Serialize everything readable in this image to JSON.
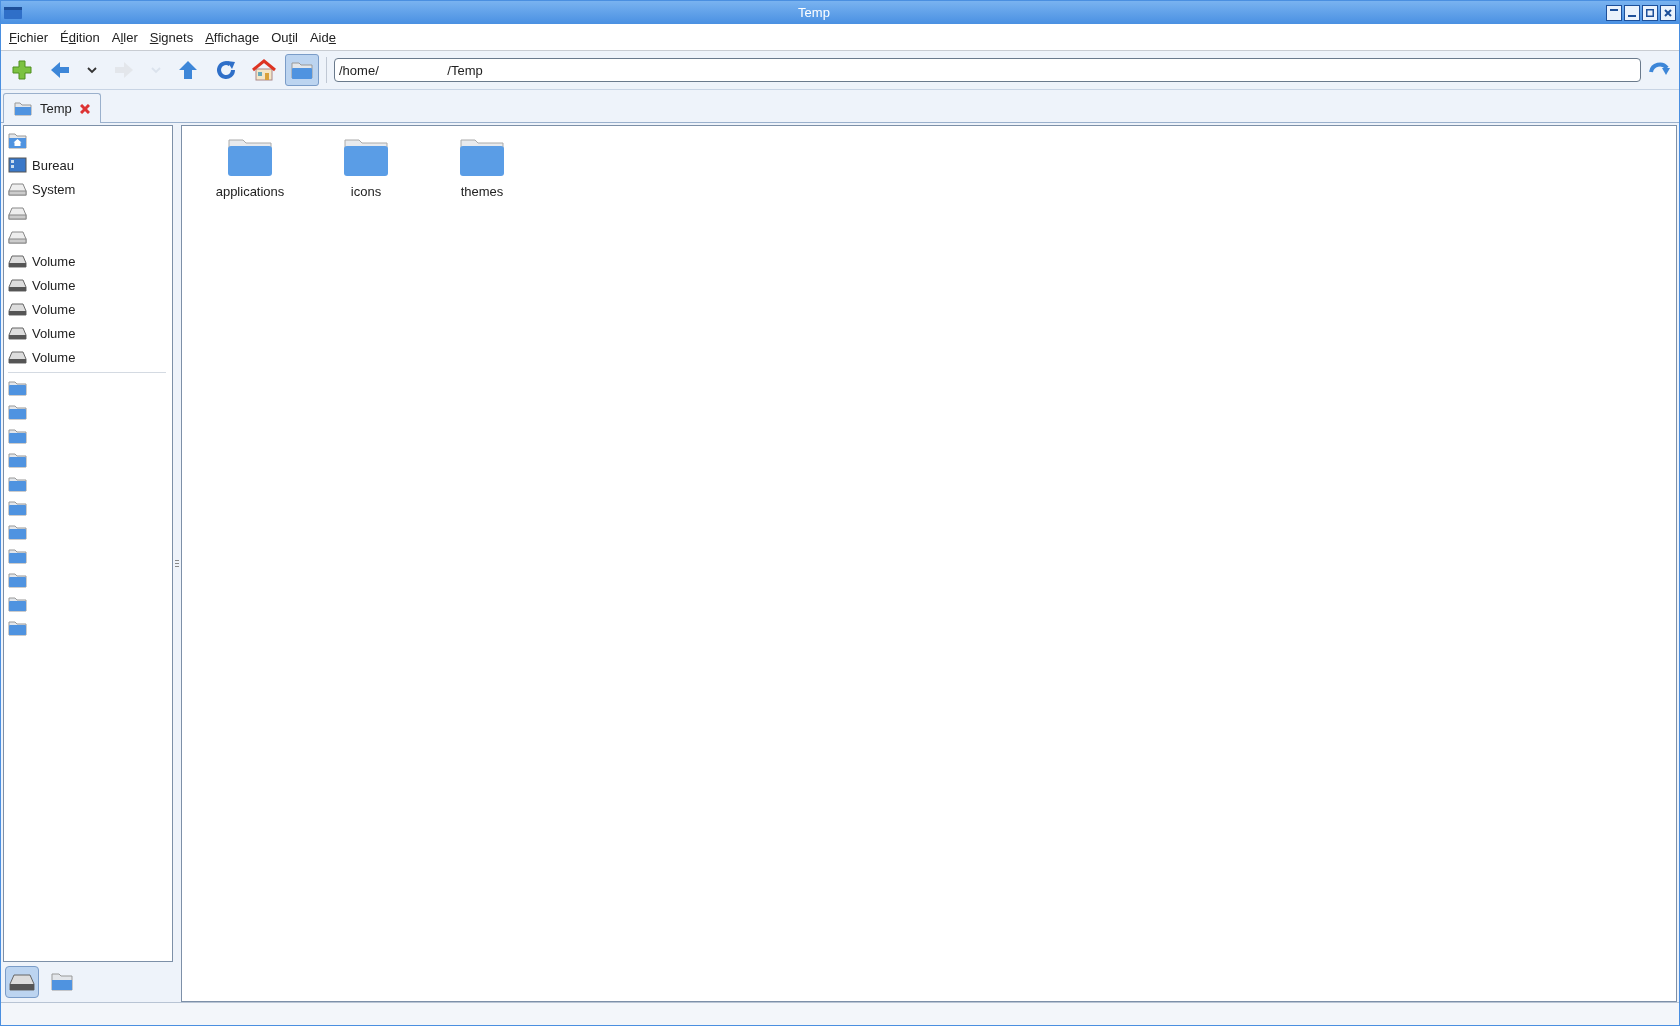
{
  "window": {
    "title": "Temp"
  },
  "menu": [
    {
      "key": "F",
      "post": "ichier"
    },
    {
      "pre": "É",
      "key": "d",
      "post": "ition"
    },
    {
      "pre": "A",
      "key": "l",
      "post": "ler"
    },
    {
      "key": "S",
      "post": "ignets"
    },
    {
      "key": "A",
      "post": "ffichage"
    },
    {
      "pre": "Ou",
      "key": "t",
      "post": "il"
    },
    {
      "pre": "Aid",
      "key": "e"
    }
  ],
  "toolbar": [
    {
      "kind": "new",
      "disabled": false,
      "selected": false
    },
    {
      "kind": "back",
      "disabled": false,
      "selected": false
    },
    {
      "kind": "dropdown",
      "disabled": false,
      "selected": false
    },
    {
      "kind": "forward",
      "disabled": true,
      "selected": false
    },
    {
      "kind": "dropdown",
      "disabled": true,
      "selected": false
    },
    {
      "kind": "up",
      "disabled": false,
      "selected": false
    },
    {
      "kind": "reload",
      "disabled": false,
      "selected": false
    },
    {
      "kind": "home",
      "disabled": false,
      "selected": false
    },
    {
      "kind": "folder",
      "disabled": false,
      "selected": true
    }
  ],
  "address": {
    "value": "/home/                   /Temp"
  },
  "tabs": [
    {
      "label": "Temp",
      "selected": true
    }
  ],
  "sidebar": {
    "places": [
      {
        "kind": "home"
      },
      {
        "kind": "desktop",
        "label": "Bureau"
      },
      {
        "kind": "drive",
        "label": "System"
      },
      {
        "kind": "drive"
      },
      {
        "kind": "drive"
      },
      {
        "kind": "volume",
        "label": "Volume"
      },
      {
        "kind": "volume",
        "label": "Volume"
      },
      {
        "kind": "volume",
        "label": "Volume"
      },
      {
        "kind": "volume",
        "label": "Volume"
      },
      {
        "kind": "volume",
        "label": "Volume"
      }
    ],
    "bookmarks": [
      {
        "kind": "folder"
      },
      {
        "kind": "folder"
      },
      {
        "kind": "folder"
      },
      {
        "kind": "folder"
      },
      {
        "kind": "folder"
      },
      {
        "kind": "folder"
      },
      {
        "kind": "folder"
      },
      {
        "kind": "folder"
      },
      {
        "kind": "folder"
      },
      {
        "kind": "folder"
      },
      {
        "kind": "folder"
      }
    ],
    "modes": [
      {
        "kind": "drive",
        "selected": true
      },
      {
        "kind": "folder",
        "selected": false
      }
    ]
  },
  "files": [
    {
      "name": "applications"
    },
    {
      "name": "icons"
    },
    {
      "name": "themes"
    }
  ]
}
